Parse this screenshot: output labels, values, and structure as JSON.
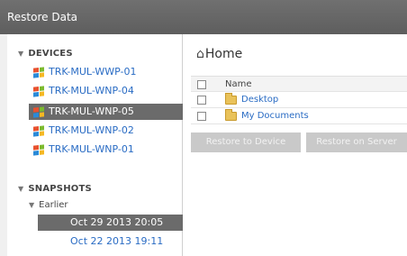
{
  "window": {
    "title": "Restore Data"
  },
  "sidebar": {
    "devices_header": "DEVICES",
    "devices": [
      {
        "label": "TRK-MUL-WWP-01",
        "selected": false
      },
      {
        "label": "TRK-MUL-WNP-04",
        "selected": false
      },
      {
        "label": "TRK-MUL-WNP-05",
        "selected": true
      },
      {
        "label": "TRK-MUL-WNP-02",
        "selected": false
      },
      {
        "label": "TRK-MUL-WNP-01",
        "selected": false
      }
    ],
    "snapshots_header": "SNAPSHOTS",
    "snapshot_group": "Earlier",
    "snapshots": [
      {
        "label": "Oct 29 2013 20:05",
        "selected": true
      },
      {
        "label": "Oct 22 2013 19:11",
        "selected": false
      }
    ]
  },
  "main": {
    "breadcrumb": "Home",
    "table": {
      "header_name": "Name",
      "rows": [
        {
          "name": "Desktop"
        },
        {
          "name": "My Documents"
        }
      ]
    },
    "buttons": {
      "restore_device": "Restore to Device",
      "restore_server": "Restore on Server"
    }
  },
  "colors": {
    "titlebar": "#666666",
    "selection": "#6b6b6b",
    "link": "#2a6cc4",
    "button_disabled": "#c9c9c9"
  },
  "icons": [
    "windows-icon",
    "home-icon",
    "folder-icon",
    "triangle-down-icon"
  ]
}
